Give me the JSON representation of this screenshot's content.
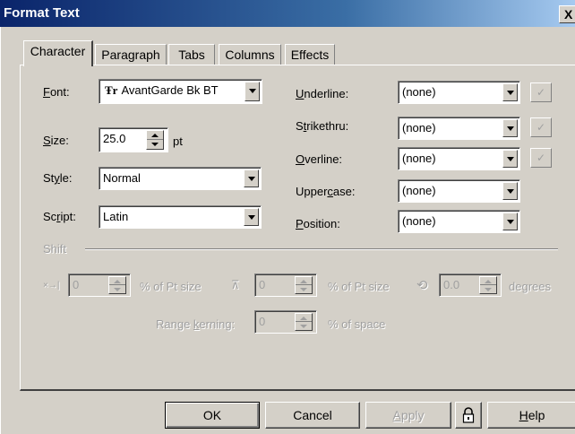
{
  "window": {
    "title": "Format Text",
    "close": "X"
  },
  "tabs": [
    {
      "label": "Character",
      "active": true
    },
    {
      "label": "Paragraph",
      "active": false
    },
    {
      "label": "Tabs",
      "active": false
    },
    {
      "label": "Columns",
      "active": false
    },
    {
      "label": "Effects",
      "active": false
    }
  ],
  "character": {
    "font_label_u": "F",
    "font_label_rest": "ont:",
    "font_value": "AvantGarde Bk BT",
    "font_icon": "Ŧr",
    "size_label_u": "S",
    "size_label_rest": "ize:",
    "size_value": "25.0",
    "size_unit": "pt",
    "style_label_a": "St",
    "style_label_u": "y",
    "style_label_rest": "le:",
    "style_value": "Normal",
    "script_label_a": "Sc",
    "script_label_u": "r",
    "script_label_rest": "ipt:",
    "script_value": "Latin",
    "underline_label_u": "U",
    "underline_label_rest": "nderline:",
    "underline_value": "(none)",
    "strikethru_label_a": "S",
    "strikethru_label_u": "t",
    "strikethru_label_rest": "rikethru:",
    "strikethru_value": "(none)",
    "overline_label_u": "O",
    "overline_label_rest": "verline:",
    "overline_value": "(none)",
    "uppercase_label_a": "Upper",
    "uppercase_label_u": "c",
    "uppercase_label_rest": "ase:",
    "uppercase_value": "(none)",
    "position_label_u": "P",
    "position_label_rest": "osition:",
    "position_value": "(none)",
    "check_glyph": "✓"
  },
  "shift": {
    "group_label": "Shift",
    "h_icon": "×→|",
    "h_value": "0",
    "h_unit": "% of Pt size",
    "v_icon": "⊼",
    "v_value": "0",
    "v_unit": "% of Pt size",
    "rot_icon": "⟲",
    "rot_value": "0.0",
    "rot_unit": "degrees",
    "kern_label_a": "Range ",
    "kern_label_u": "k",
    "kern_label_rest": "erning:",
    "kern_value": "0",
    "kern_unit": "% of space"
  },
  "buttons": {
    "ok": "OK",
    "cancel": "Cancel",
    "apply_u": "A",
    "apply_rest": "pply",
    "lock_icon": "lock-icon",
    "help_u": "H",
    "help_rest": "elp"
  }
}
